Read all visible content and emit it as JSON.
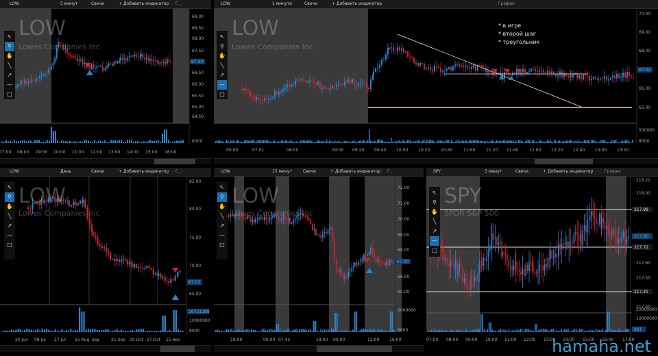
{
  "colors": {
    "up": "#2288d8",
    "down": "#d02323",
    "session": "#3a3a3a",
    "grid": "#1d1d1d",
    "line_white": "#e6e6e6",
    "line_yellow": "#ffd22a",
    "volume": "#2a86cf",
    "tool_active": "#1a6fb0",
    "brand": "#3aa0d0"
  },
  "toolbar_icons": [
    "cursor-icon",
    "zoom-icon",
    "hand-icon",
    "line-icon",
    "ray-icon",
    "hline-icon",
    "rect-icon"
  ],
  "panels": {
    "p1": {
      "header": {
        "symbol": "LOW",
        "interval": "5 минут",
        "type": "Свечи",
        "add": "+ Добавить индикатор",
        "extra": "Г..."
      },
      "watermark": "LOW",
      "subtitle": "Lowes Companies Inc",
      "price_ticks": [
        "69.00",
        "68.50",
        "68.00",
        "67.50",
        "67.00",
        "66.50",
        "66.00",
        "65.50",
        "65.00",
        "64.50"
      ],
      "price_badge": "67.00",
      "volume_ticks": [
        "8000"
      ],
      "time_ticks": [
        "07:00",
        "08:00",
        "09:00",
        "10:00",
        "11:00",
        "12:00",
        "13:00",
        "14:00",
        "15:00",
        "16:00"
      ]
    },
    "p2": {
      "header": {
        "symbol": "LOW",
        "interval": "1 минута",
        "type": "Свечи",
        "add": "+ Добавить индикатор",
        "title": "График"
      },
      "watermark": "LOW",
      "subtitle": "Lowes Companies Inc",
      "notes": [
        "* в игре",
        "* второй шаг",
        "* треугольник"
      ],
      "price_ticks": [
        "70.00",
        "69.00",
        "68.00",
        "67.00",
        "66.00",
        "65.00"
      ],
      "price_badge": "67.02",
      "volume_ticks": [
        "500000",
        "8000"
      ],
      "time_ticks": [
        "00:00",
        "07:01",
        "08:00",
        "09:00",
        "09:20",
        "09:40",
        "10:00",
        "10:20",
        "10:40",
        "11:00",
        "11:20",
        "11:40",
        "12:00",
        "12:20",
        "12:40",
        "13:00",
        "13:20"
      ]
    },
    "p3": {
      "header": {
        "symbol": "LOW",
        "interval": "День",
        "type": "Свечи",
        "add": "+ Добавить индикатор",
        "extra": "Г..."
      },
      "watermark": "LOW",
      "subtitle": "Lowes Companies Inc",
      "price_ticks": [
        "85.00",
        "80.00",
        "75.00",
        "70.00",
        "65.00"
      ],
      "price_badge": "67.02",
      "volume_ticks": [
        "16721188",
        "10000000",
        "8000"
      ],
      "time_ticks": [
        "20 Jun",
        "08 Jul",
        "27 Jul",
        "15 Aug",
        "Sep",
        "21 Sep",
        "10 Oct",
        "27 Oct",
        "15 Nov"
      ]
    },
    "p4": {
      "header": {
        "symbol": "LOW",
        "interval": "15 минут",
        "type": "Свечи",
        "add": "+ Добавить индикатор",
        "extra": "Г..."
      },
      "watermark": "LOW",
      "subtitle": "Lowes Companies Inc",
      "price_ticks": [
        "72.00",
        "71.00",
        "70.00",
        "69.00",
        "68.00",
        "67.00",
        "66.00",
        "65.00"
      ],
      "price_badge": "67.00",
      "volume_ticks": [
        "2000000",
        "8000"
      ],
      "time_ticks": [
        "18:00",
        "00:00",
        "07:45",
        "18:00",
        "00:00",
        "12:00",
        "16:00"
      ]
    },
    "p5": {
      "header": {
        "symbol": "SPY",
        "interval": "5 минут",
        "type": "Свечи",
        "add": "+ Добавить индикатор",
        "title": "График"
      },
      "watermark": "SPY",
      "subtitle": "SPDR S&P 500",
      "price_ticks": [
        "218.20",
        "218.00",
        "217.80",
        "217.60",
        "217.50",
        "217.40",
        "217.20"
      ],
      "level_badges": [
        "217.99",
        "217.72",
        "217.41"
      ],
      "price_badge": "217.80",
      "volume_ticks": [
        "20000000",
        "10000000",
        "821"
      ],
      "time_ticks": [
        "07:00",
        "08:00",
        "09:00",
        "10:00",
        "11:00",
        "12:00",
        "13:00",
        "14:00",
        "15:00",
        "16:00",
        "17:00"
      ]
    }
  },
  "brand": "hamaha.net"
}
